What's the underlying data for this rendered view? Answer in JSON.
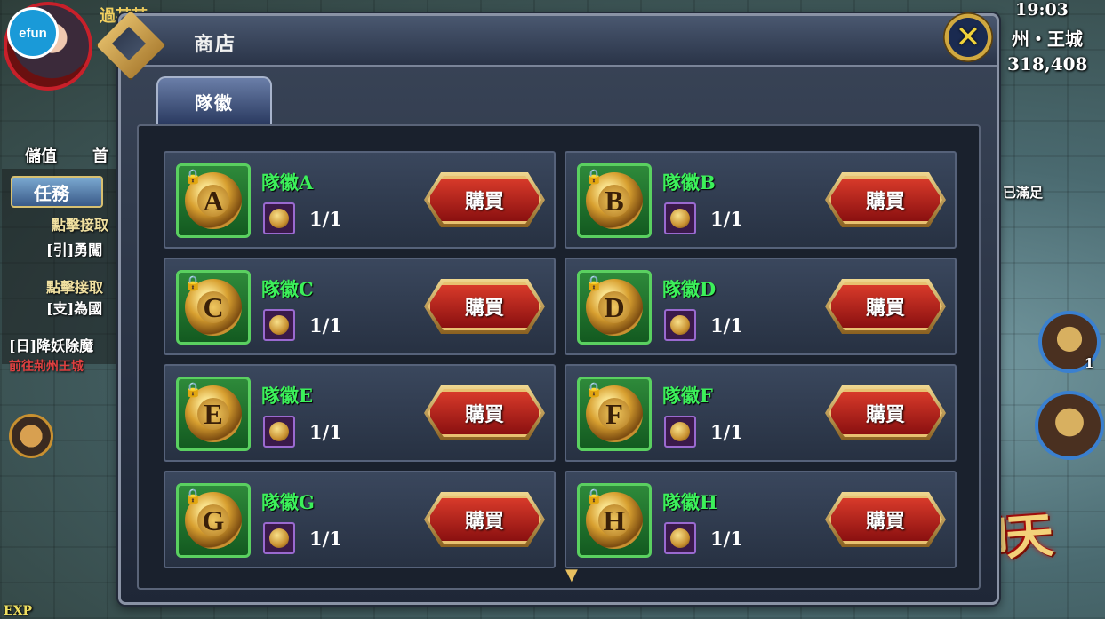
{
  "hud": {
    "logo_badge": "efun",
    "player_name": "過某某",
    "time": "19:03",
    "location": "州・王城",
    "currency": "318,408",
    "menu_recharge": "儲值",
    "menu_first": "首",
    "quest_button": "任務",
    "quest_lines": [
      "點擊接取",
      "[引]勇闖",
      "點擊接取",
      "[支]為國",
      "[日]降妖除魔",
      "前往荊州王城"
    ],
    "status_satisfied": "已滿足",
    "skill_count": "1",
    "exp_label": "EXP",
    "game_logo": "六龍御天"
  },
  "shop": {
    "title": "商店",
    "close_symbol": "✕",
    "tab_label": "隊徽",
    "scroll_indicator": "▼",
    "buy_label": "購買",
    "items": [
      {
        "letter": "A",
        "name": "隊徽A",
        "quantity": "1/1"
      },
      {
        "letter": "B",
        "name": "隊徽B",
        "quantity": "1/1"
      },
      {
        "letter": "C",
        "name": "隊徽C",
        "quantity": "1/1"
      },
      {
        "letter": "D",
        "name": "隊徽D",
        "quantity": "1/1"
      },
      {
        "letter": "E",
        "name": "隊徽E",
        "quantity": "1/1"
      },
      {
        "letter": "F",
        "name": "隊徽F",
        "quantity": "1/1"
      },
      {
        "letter": "G",
        "name": "隊徽G",
        "quantity": "1/1"
      },
      {
        "letter": "H",
        "name": "隊徽H",
        "quantity": "1/1"
      }
    ]
  },
  "colors": {
    "item_name": "#3cf05a",
    "buy_button": "#c82a1e",
    "frame_gold": "#e8c070"
  }
}
